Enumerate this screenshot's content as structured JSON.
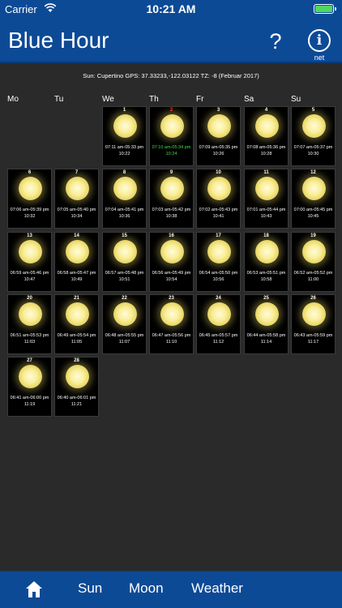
{
  "status": {
    "carrier": "Carrier",
    "time": "10:21 AM"
  },
  "nav": {
    "title": "Blue Hour",
    "help": "?",
    "info": "i",
    "info_sub": "net"
  },
  "location": "Sun: Cupertino GPS: 37.33233,-122.03122 TZ: -8 (Februar 2017)",
  "weekdays": [
    "Mo",
    "Tu",
    "We",
    "Th",
    "Fr",
    "Sa",
    "Su"
  ],
  "days": [
    {
      "day": "1",
      "time": "07:11 am-05:33 pm",
      "dur": "10:22",
      "col": 2,
      "row": 0
    },
    {
      "day": "2",
      "time": "07:10 am-05:34 pm",
      "dur": "10:24",
      "col": 3,
      "row": 0,
      "today": true
    },
    {
      "day": "3",
      "time": "07:09 am-05:35 pm",
      "dur": "10:26",
      "col": 4,
      "row": 0
    },
    {
      "day": "4",
      "time": "07:08 am-05:36 pm",
      "dur": "10:28",
      "col": 5,
      "row": 0
    },
    {
      "day": "5",
      "time": "07:07 am-05:37 pm",
      "dur": "10:30",
      "col": 6,
      "row": 0
    },
    {
      "day": "6",
      "time": "07:06 am-05:39 pm",
      "dur": "10:32",
      "col": 0,
      "row": 1
    },
    {
      "day": "7",
      "time": "07:05 am-05:40 pm",
      "dur": "10:34",
      "col": 1,
      "row": 1
    },
    {
      "day": "8",
      "time": "07:04 am-05:41 pm",
      "dur": "10:36",
      "col": 2,
      "row": 1
    },
    {
      "day": "9",
      "time": "07:03 am-05:42 pm",
      "dur": "10:38",
      "col": 3,
      "row": 1
    },
    {
      "day": "10",
      "time": "07:02 am-05:43 pm",
      "dur": "10:41",
      "col": 4,
      "row": 1
    },
    {
      "day": "11",
      "time": "07:01 am-05:44 pm",
      "dur": "10:43",
      "col": 5,
      "row": 1
    },
    {
      "day": "12",
      "time": "07:00 am-05:45 pm",
      "dur": "10:45",
      "col": 6,
      "row": 1
    },
    {
      "day": "13",
      "time": "06:59 am-05:46 pm",
      "dur": "10:47",
      "col": 0,
      "row": 2
    },
    {
      "day": "14",
      "time": "06:58 am-05:47 pm",
      "dur": "10:49",
      "col": 1,
      "row": 2
    },
    {
      "day": "15",
      "time": "06:57 am-05:48 pm",
      "dur": "10:51",
      "col": 2,
      "row": 2
    },
    {
      "day": "16",
      "time": "06:56 am-05:49 pm",
      "dur": "10:54",
      "col": 3,
      "row": 2
    },
    {
      "day": "17",
      "time": "06:54 am-05:50 pm",
      "dur": "10:56",
      "col": 4,
      "row": 2
    },
    {
      "day": "18",
      "time": "06:53 am-05:51 pm",
      "dur": "10:58",
      "col": 5,
      "row": 2
    },
    {
      "day": "19",
      "time": "06:52 am-05:52 pm",
      "dur": "11:00",
      "col": 6,
      "row": 2
    },
    {
      "day": "20",
      "time": "06:51 am-05:53 pm",
      "dur": "11:03",
      "col": 0,
      "row": 3
    },
    {
      "day": "21",
      "time": "06:49 am-05:54 pm",
      "dur": "11:05",
      "col": 1,
      "row": 3
    },
    {
      "day": "22",
      "time": "06:48 am-05:55 pm",
      "dur": "11:07",
      "col": 2,
      "row": 3
    },
    {
      "day": "23",
      "time": "06:47 am-05:56 pm",
      "dur": "11:10",
      "col": 3,
      "row": 3
    },
    {
      "day": "24",
      "time": "06:45 am-05:57 pm",
      "dur": "11:12",
      "col": 4,
      "row": 3
    },
    {
      "day": "25",
      "time": "06:44 am-05:58 pm",
      "dur": "11:14",
      "col": 5,
      "row": 3
    },
    {
      "day": "26",
      "time": "06:43 am-05:59 pm",
      "dur": "11:17",
      "col": 6,
      "row": 3
    },
    {
      "day": "27",
      "time": "06:41 am-06:00 pm",
      "dur": "11:19",
      "col": 0,
      "row": 4
    },
    {
      "day": "28",
      "time": "06:40 am-06:01 pm",
      "dur": "11:21",
      "col": 1,
      "row": 4
    }
  ],
  "tabs": {
    "sun": "Sun",
    "moon": "Moon",
    "weather": "Weather"
  },
  "colors": {
    "bar": "#0d4a96",
    "background": "#2a2a2a",
    "today": "#3ee04a",
    "sunday_marker": "#ff2e2e"
  }
}
